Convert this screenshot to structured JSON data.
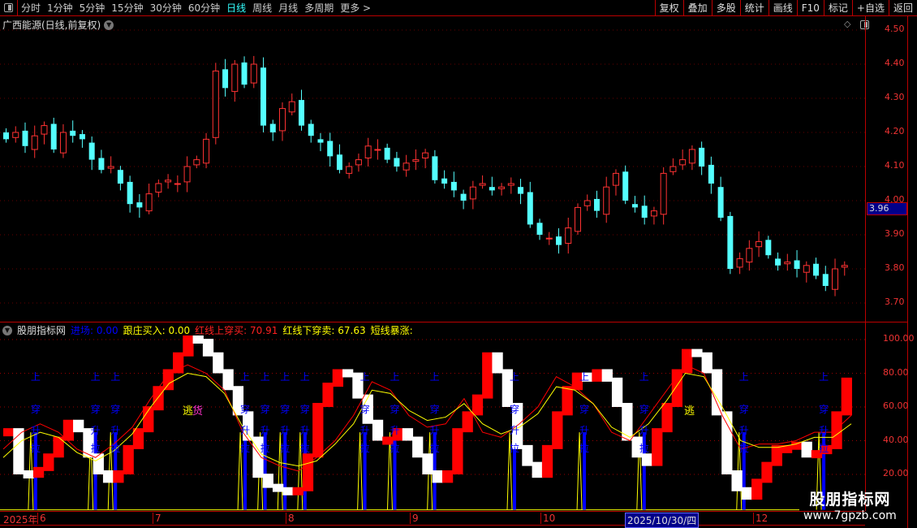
{
  "toolbar": {
    "periods": [
      "分时",
      "1分钟",
      "5分钟",
      "15分钟",
      "30分钟",
      "60分钟",
      "日线",
      "周线",
      "月线",
      "多周期",
      "更多 >"
    ],
    "active": "日线",
    "buttons": [
      "复权",
      "叠加",
      "多股",
      "统计",
      "画线",
      "F10",
      "标记",
      "+自选",
      "返回"
    ]
  },
  "main": {
    "title": "广西能源(日线,前复权)",
    "price_ticks": [
      "4.50",
      "4.40",
      "4.30",
      "4.20",
      "4.10",
      "4.00",
      "3.90",
      "3.80",
      "3.70"
    ],
    "current_price": "3.96"
  },
  "indicator": {
    "name": "股朋指标网",
    "legend": [
      {
        "label": "进场: 0.00",
        "color": "#0000ff"
      },
      {
        "label": "跟庄买入: 0.00",
        "color": "#ffff00"
      },
      {
        "label": "红线上穿买: 70.91",
        "color": "#ff2020"
      },
      {
        "label": "红线下穿卖: 67.63",
        "color": "#ffff00"
      },
      {
        "label": "短线暴涨:",
        "color": "#ffff00"
      }
    ],
    "ticks": [
      "100.00",
      "80.00",
      "60.00",
      "40.00",
      "20.00"
    ],
    "escape_label": [
      "逃",
      "货"
    ]
  },
  "time_axis": {
    "labels": [
      "2025年",
      "6",
      "7",
      "8",
      "9",
      "10",
      "12"
    ],
    "highlight": "2025/10/30/四"
  },
  "watermark": {
    "name": "股朋指标网",
    "url": "www.7gpzb.com"
  },
  "colors": {
    "up": "#ff3232",
    "down": "#54ffff",
    "block_up": "#ff0000",
    "block_down": "#ffffff",
    "line_red": "#ff0000",
    "line_yellow": "#ffff00",
    "signal": "#0000ff"
  },
  "chart_data": [
    {
      "type": "candlestick",
      "ylim": [
        3.66,
        4.52
      ],
      "close": [
        4.18,
        4.2,
        4.16,
        4.19,
        4.22,
        4.15,
        4.2,
        4.19,
        4.18,
        4.12,
        4.09,
        4.1,
        4.05,
        3.99,
        3.98,
        4.02,
        4.05,
        4.06,
        4.05,
        4.1,
        4.12,
        4.18,
        4.38,
        4.33,
        4.4,
        4.34,
        4.4,
        4.22,
        4.2,
        4.27,
        4.29,
        4.22,
        4.19,
        4.17,
        4.13,
        4.09,
        4.1,
        4.12,
        4.16,
        4.15,
        4.12,
        4.1,
        4.11,
        4.12,
        4.14,
        4.06,
        4.05,
        4.03,
        4.0,
        4.04,
        4.05,
        4.03,
        4.04,
        4.05,
        4.02,
        3.93,
        3.9,
        3.89,
        3.87,
        3.92,
        3.98,
        4.0,
        3.97,
        4.04,
        4.08,
        4.0,
        3.98,
        3.95,
        3.97,
        4.08,
        4.1,
        4.12,
        4.15,
        4.1,
        4.05,
        3.95,
        3.8,
        3.83,
        3.86,
        3.88,
        3.84,
        3.81,
        3.82,
        3.8,
        3.81,
        3.78,
        3.75,
        3.8,
        3.81
      ],
      "current": 3.96
    },
    {
      "type": "step-blocks",
      "ylim": [
        0,
        100
      ],
      "values": [
        45,
        20,
        18,
        22,
        30,
        40,
        50,
        45,
        30,
        20,
        15,
        20,
        35,
        45,
        58,
        70,
        80,
        90,
        100,
        98,
        90,
        80,
        70,
        55,
        40,
        18,
        12,
        10,
        8,
        10,
        30,
        60,
        72,
        80,
        78,
        65,
        50,
        40,
        40,
        45,
        40,
        30,
        20,
        15,
        20,
        45,
        55,
        65,
        90,
        80,
        60,
        35,
        25,
        18,
        35,
        55,
        70,
        78,
        75,
        80,
        75,
        60,
        40,
        30,
        25,
        45,
        60,
        80,
        92,
        90,
        80,
        55,
        20,
        10,
        5,
        15,
        25,
        35,
        35,
        37,
        30,
        32,
        35,
        55,
        75
      ],
      "red_line": [
        35,
        45,
        50,
        45,
        35,
        30,
        38,
        48,
        65,
        80,
        85,
        80,
        70,
        45,
        30,
        25,
        22,
        30,
        40,
        55,
        75,
        70,
        55,
        48,
        50,
        65,
        45,
        42,
        50,
        60,
        78,
        72,
        62,
        45,
        40,
        55,
        70,
        85,
        80,
        55,
        35,
        38,
        38,
        40,
        45,
        45,
        55
      ],
      "yellow_line": [
        30,
        40,
        45,
        42,
        33,
        28,
        34,
        44,
        60,
        74,
        80,
        78,
        68,
        48,
        32,
        27,
        25,
        28,
        38,
        50,
        70,
        68,
        58,
        52,
        54,
        62,
        50,
        44,
        48,
        56,
        72,
        70,
        62,
        48,
        42,
        50,
        64,
        80,
        78,
        60,
        40,
        36,
        36,
        38,
        42,
        42,
        50
      ],
      "signals": [
        3,
        9,
        11,
        24,
        26,
        28,
        30,
        36,
        39,
        43,
        51,
        58,
        64,
        74,
        82
      ]
    }
  ]
}
